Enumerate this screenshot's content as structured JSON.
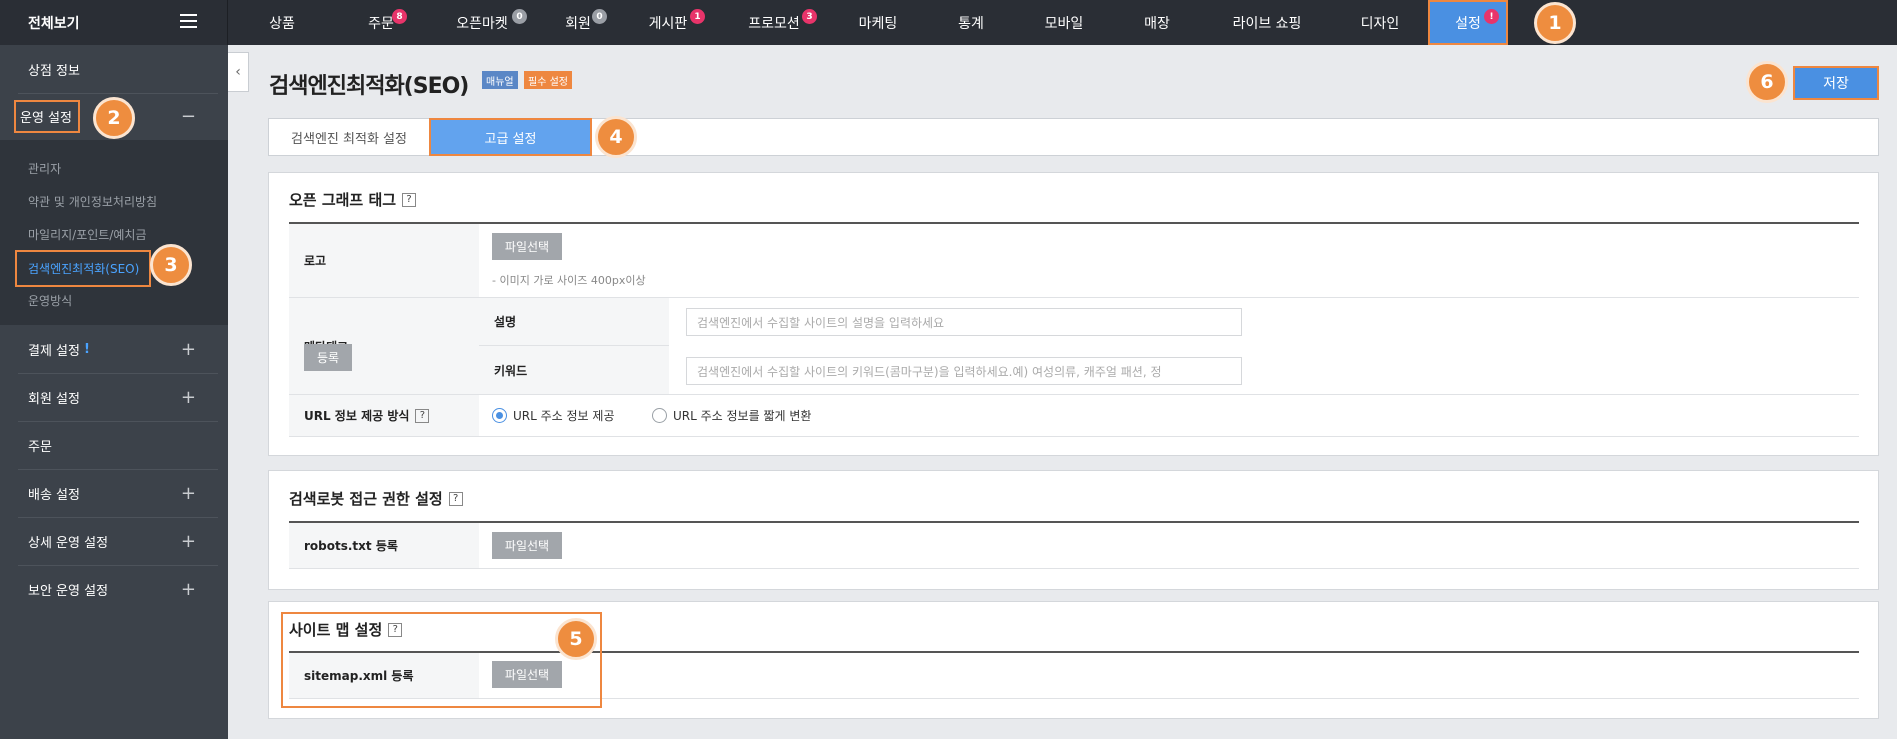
{
  "topbar": {
    "all_label": "전체보기",
    "menu": [
      {
        "label": "상품",
        "badge": null,
        "badge_color": null
      },
      {
        "label": "주문",
        "badge": "8",
        "badge_color": "pink"
      },
      {
        "label": "오픈마켓",
        "badge": "0",
        "badge_color": "gray"
      },
      {
        "label": "회원",
        "badge": "0",
        "badge_color": "gray"
      },
      {
        "label": "게시판",
        "badge": "1",
        "badge_color": "pink"
      },
      {
        "label": "프로모션",
        "badge": "3",
        "badge_color": "pink"
      },
      {
        "label": "마케팅",
        "badge": null,
        "badge_color": null
      },
      {
        "label": "통계",
        "badge": null,
        "badge_color": null
      },
      {
        "label": "모바일",
        "badge": null,
        "badge_color": null
      },
      {
        "label": "매장",
        "badge": null,
        "badge_color": null
      },
      {
        "label": "라이브 쇼핑",
        "badge": null,
        "badge_color": null
      },
      {
        "label": "디자인",
        "badge": null,
        "badge_color": null
      },
      {
        "label": "설정",
        "badge": "!",
        "badge_color": "pink"
      }
    ]
  },
  "callouts": [
    "1",
    "2",
    "3",
    "4",
    "5",
    "6"
  ],
  "sidebar": {
    "store_info": "상점 정보",
    "operation": "운영 설정",
    "operation_sign": "−",
    "sub": [
      "관리자",
      "약관 및 개인정보처리방침",
      "마일리지/포인트/예치금",
      "검색엔진최적화(SEO)",
      "운영방식"
    ],
    "groups": [
      {
        "label": "결제 설정",
        "alert": "!",
        "sign": "+"
      },
      {
        "label": "회원 설정",
        "alert": null,
        "sign": "+"
      },
      {
        "label": "주문",
        "alert": null,
        "sign": ""
      },
      {
        "label": "배송 설정",
        "alert": null,
        "sign": "+"
      },
      {
        "label": "상세 운영 설정",
        "alert": null,
        "sign": "+"
      },
      {
        "label": "보안 운영 설정",
        "alert": null,
        "sign": "+"
      }
    ]
  },
  "main": {
    "title": "검색엔진최적화(SEO)",
    "tag_manual": "매뉴얼",
    "tag_required": "필수 설정",
    "save": "저장",
    "tabs": [
      "검색엔진 최적화 설정",
      "고급 설정"
    ],
    "og": {
      "title": "오픈 그래프 태그",
      "logo_label": "로고",
      "file_btn": "파일선택",
      "logo_help": "- 이미지 가로 사이즈 400px이상",
      "meta_label": "메타태그",
      "reg_btn": "등록",
      "desc_label": "설명",
      "desc_placeholder": "검색엔진에서 수집할 사이트의 설명을 입력하세요",
      "kw_label": "키워드",
      "kw_placeholder": "검색엔진에서 수집할 사이트의 키워드(콤마구분)을 입력하세요.예) 여성의류, 캐주얼 패션, 정",
      "url_label": "URL 정보 제공 방식",
      "url_opt1": "URL 주소 정보 제공",
      "url_opt2": "URL 주소 정보를 짧게 변환"
    },
    "robots": {
      "title": "검색로봇 접근 권한 설정",
      "label": "robots.txt 등록",
      "file_btn": "파일선택"
    },
    "sitemap": {
      "title": "사이트 맵 설정",
      "label": "sitemap.xml 등록",
      "file_btn": "파일선택"
    }
  }
}
